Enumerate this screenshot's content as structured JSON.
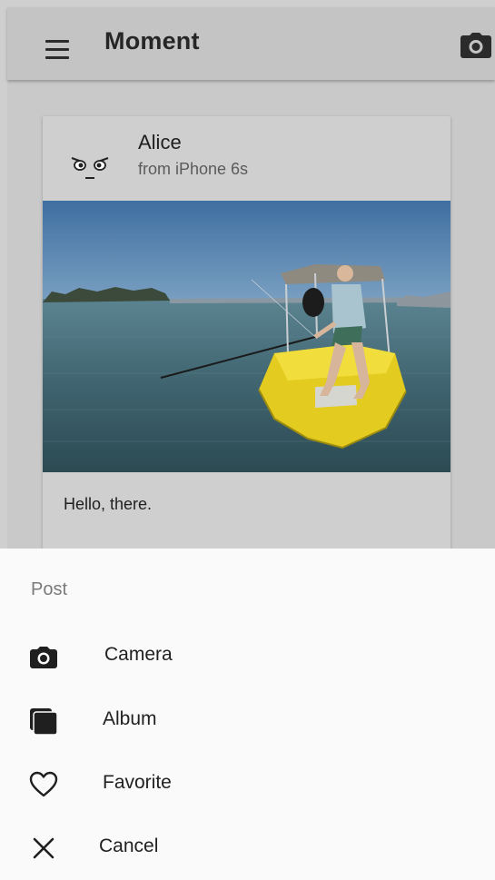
{
  "appbar": {
    "title": "Moment",
    "menu_icon": "menu-icon",
    "action_icon": "camera-icon"
  },
  "post": {
    "author": "Alice",
    "source": "from iPhone 6s",
    "avatar_icon": "face-emoji-icon",
    "photo": "man-fishing-in-yellow-boat-on-water",
    "caption": "Hello, there."
  },
  "sheet": {
    "title": "Post",
    "items": [
      {
        "label": "Camera",
        "icon": "camera-icon"
      },
      {
        "label": "Album",
        "icon": "album-icon"
      },
      {
        "label": "Favorite",
        "icon": "heart-outline-icon"
      },
      {
        "label": "Cancel",
        "icon": "close-icon"
      }
    ]
  },
  "colors": {
    "scrim_background": "#c9c9c9",
    "sheet_background": "#fafafa",
    "text_primary": "#212121",
    "text_secondary": "#7a7a7a"
  }
}
